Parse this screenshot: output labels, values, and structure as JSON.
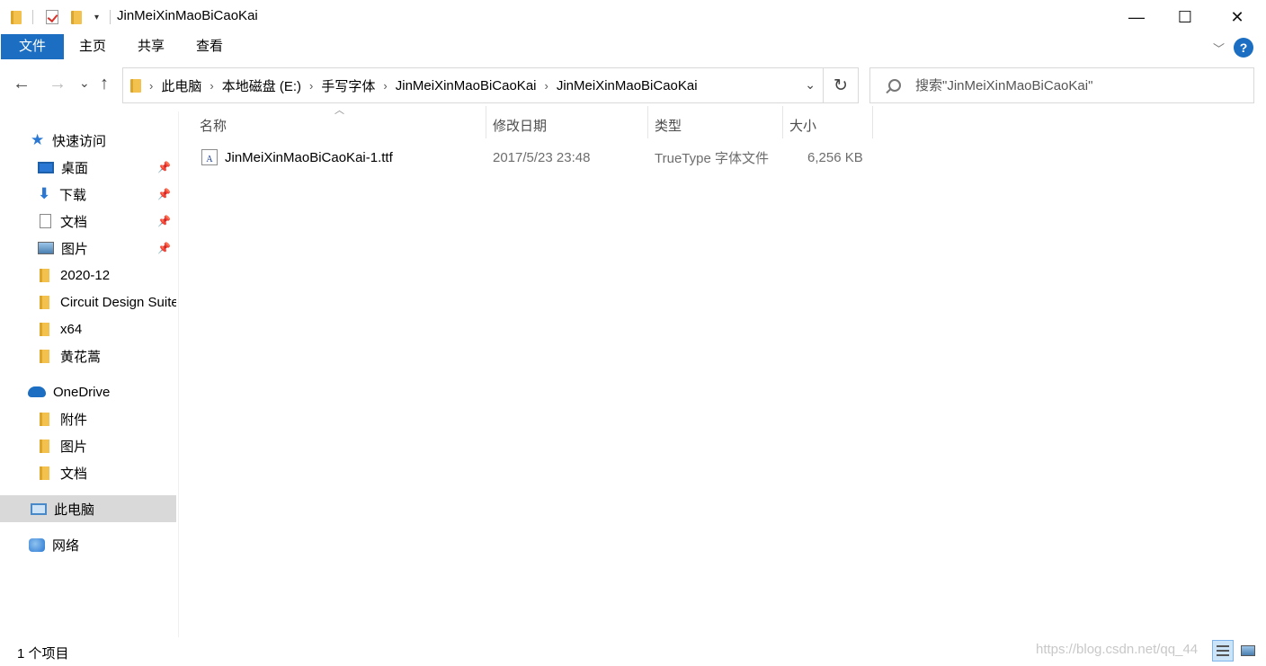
{
  "window": {
    "title": "JinMeiXinMaoBiCaoKai",
    "minimize": "—",
    "maximize": "☐",
    "close": "✕"
  },
  "ribbon": {
    "tabs": [
      "文件",
      "主页",
      "共享",
      "查看"
    ],
    "help": "?"
  },
  "nav": {
    "back": "←",
    "forward": "→",
    "recent": "⌄",
    "up": "↑",
    "breadcrumb": [
      "此电脑",
      "本地磁盘 (E:)",
      "手写字体",
      "JinMeiXinMaoBiCaoKai",
      "JinMeiXinMaoBiCaoKai"
    ],
    "refresh": "↻",
    "search_placeholder": "搜索\"JinMeiXinMaoBiCaoKai\""
  },
  "sidebar": {
    "items": [
      {
        "label": "快速访问",
        "icon": "star-icon",
        "pinned": false
      },
      {
        "label": "桌面",
        "icon": "desktop-icon",
        "pinned": true
      },
      {
        "label": "下载",
        "icon": "download-icon",
        "pinned": true
      },
      {
        "label": "文档",
        "icon": "document-icon",
        "pinned": true
      },
      {
        "label": "图片",
        "icon": "pictures-icon",
        "pinned": true
      },
      {
        "label": "2020-12",
        "icon": "folder-icon",
        "pinned": false
      },
      {
        "label": "Circuit Design Suite",
        "icon": "folder-icon",
        "pinned": false
      },
      {
        "label": "x64",
        "icon": "folder-icon",
        "pinned": false
      },
      {
        "label": "黄花蒿",
        "icon": "folder-icon",
        "pinned": false
      },
      {
        "label": "OneDrive",
        "icon": "onedrive-icon",
        "pinned": false
      },
      {
        "label": "附件",
        "icon": "folder-icon",
        "pinned": false
      },
      {
        "label": "图片",
        "icon": "folder-icon",
        "pinned": false
      },
      {
        "label": "文档",
        "icon": "folder-icon",
        "pinned": false
      },
      {
        "label": "此电脑",
        "icon": "this-pc-icon",
        "pinned": false,
        "selected": true
      },
      {
        "label": "网络",
        "icon": "network-icon",
        "pinned": false
      }
    ]
  },
  "list": {
    "columns": [
      "名称",
      "修改日期",
      "类型",
      "大小"
    ],
    "rows": [
      {
        "name": "JinMeiXinMaoBiCaoKai-1.ttf",
        "modified": "2017/5/23 23:48",
        "type": "TrueType 字体文件",
        "size": "6,256 KB"
      }
    ]
  },
  "status": {
    "count": "1 个项目",
    "watermark": "https://blog.csdn.net/qq_44"
  },
  "colors": {
    "accent": "#1b6ec2",
    "selected_bg": "#d9d9d9",
    "folder": "#f2c14e"
  }
}
